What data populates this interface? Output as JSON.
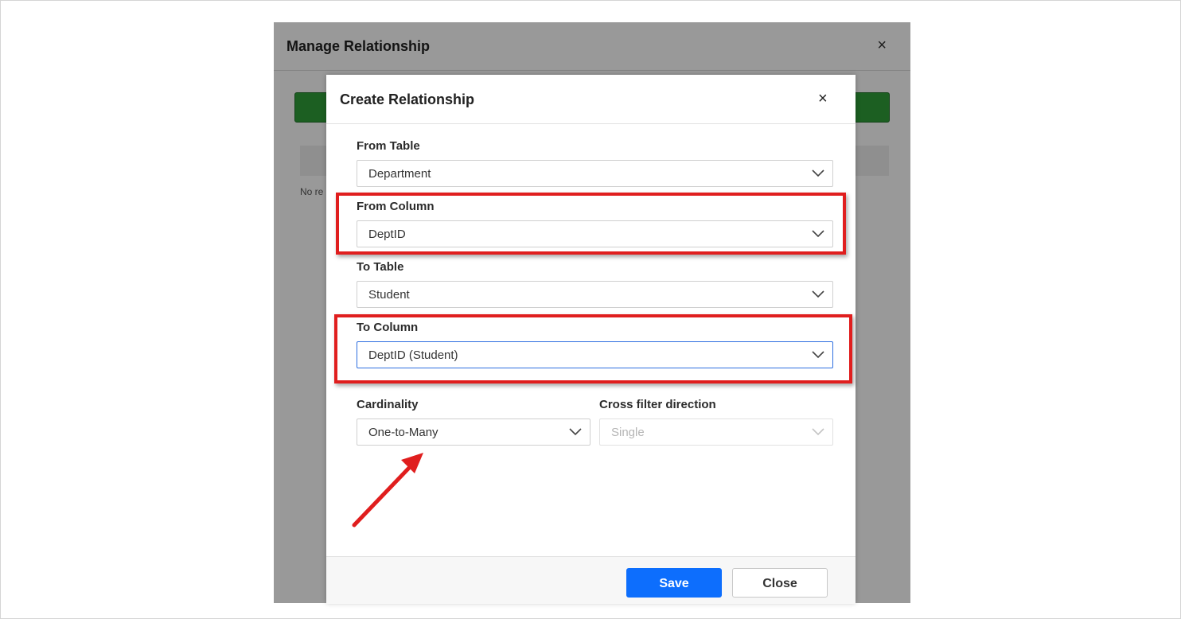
{
  "manage_dialog": {
    "title": "Manage Relationship",
    "close_glyph": "×",
    "no_records_text": "No re"
  },
  "create_dialog": {
    "title": "Create Relationship",
    "close_glyph": "×",
    "fields": {
      "from_table": {
        "label": "From Table",
        "value": "Department"
      },
      "from_column": {
        "label": "From Column",
        "value": "DeptID"
      },
      "to_table": {
        "label": "To Table",
        "value": "Student"
      },
      "to_column": {
        "label": "To Column",
        "value": "DeptID (Student)"
      },
      "cardinality": {
        "label": "Cardinality",
        "value": "One-to-Many"
      },
      "cross_filter": {
        "label": "Cross filter direction",
        "value": "Single",
        "disabled": true
      }
    },
    "buttons": {
      "save": "Save",
      "close": "Close"
    }
  },
  "annotations": {
    "highlight_color": "#e01e1e",
    "highlighted_fields": [
      "From Column",
      "To Column"
    ],
    "arrow_target": "Cardinality"
  },
  "colors": {
    "primary": "#0d6efd",
    "bg_green": "#2f9e3a",
    "focus_border": "#2e6fe0"
  },
  "icons": {
    "dropdown": "chevron-down-icon",
    "close": "close-icon",
    "arrow": "red-arrow-annotation"
  }
}
